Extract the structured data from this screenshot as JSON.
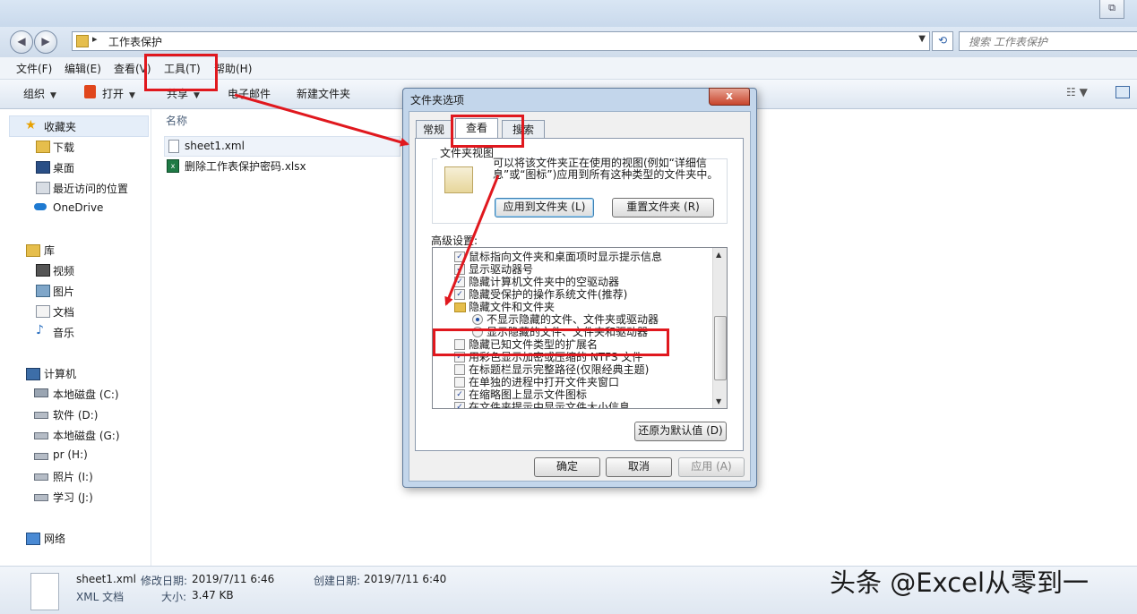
{
  "window": {
    "restore_glyph": "⧉"
  },
  "address": {
    "path": "工作表保护",
    "search_placeholder": "搜索 工作表保护"
  },
  "menu": [
    "文件(F)",
    "编辑(E)",
    "查看(V)",
    "工具(T)",
    "帮助(H)"
  ],
  "toolbar": {
    "organize": "组织",
    "open": "打开",
    "share": "共享",
    "email": "电子邮件",
    "new_folder": "新建文件夹"
  },
  "nav": {
    "favorites": "收藏夹",
    "fav_items": [
      "下载",
      "桌面",
      "最近访问的位置",
      "OneDrive"
    ],
    "library": "库",
    "lib_items": [
      "视频",
      "图片",
      "文档",
      "音乐"
    ],
    "computer": "计算机",
    "drives": [
      "本地磁盘 (C:)",
      "软件 (D:)",
      "本地磁盘 (G:)",
      "pr (H:)",
      "照片 (I:)",
      "学习 (J:)"
    ],
    "network": "网络"
  },
  "content": {
    "col_name": "名称",
    "files": [
      "sheet1.xml",
      "删除工作表保护密码.xlsx"
    ]
  },
  "status": {
    "filename": "sheet1.xml",
    "modified_label": "修改日期:",
    "modified": "2019/7/11 6:46",
    "created_label": "创建日期:",
    "created": "2019/7/11 6:40",
    "type": "XML 文档",
    "size_label": "大小:",
    "size": "3.47 KB"
  },
  "watermark": "头条 @Excel从零到一",
  "dialog": {
    "title": "文件夹选项",
    "close": "x",
    "tabs": [
      "常规",
      "查看",
      "搜索"
    ],
    "group_label": "文件夹视图",
    "group_desc": "可以将该文件夹正在使用的视图(例如“详细信息”或“图标”)应用到所有这种类型的文件夹中。",
    "apply_to_folders": "应用到文件夹 (L)",
    "reset_folders": "重置文件夹 (R)",
    "advanced_label": "高级设置:",
    "settings": [
      {
        "kind": "check",
        "checked": true,
        "label": "鼠标指向文件夹和桌面项时显示提示信息"
      },
      {
        "kind": "check",
        "checked": true,
        "label": "显示驱动器号"
      },
      {
        "kind": "check",
        "checked": true,
        "label": "隐藏计算机文件夹中的空驱动器"
      },
      {
        "kind": "check",
        "checked": true,
        "label": "隐藏受保护的操作系统文件(推荐)"
      },
      {
        "kind": "folder",
        "label": "隐藏文件和文件夹"
      },
      {
        "kind": "radio",
        "checked": true,
        "label": "不显示隐藏的文件、文件夹或驱动器"
      },
      {
        "kind": "radio",
        "checked": false,
        "label": "显示隐藏的文件、文件夹和驱动器"
      },
      {
        "kind": "check",
        "checked": false,
        "label": "隐藏已知文件类型的扩展名"
      },
      {
        "kind": "check",
        "checked": true,
        "label": "用彩色显示加密或压缩的 NTFS 文件"
      },
      {
        "kind": "check",
        "checked": false,
        "label": "在标题栏显示完整路径(仅限经典主题)"
      },
      {
        "kind": "check",
        "checked": false,
        "label": "在单独的进程中打开文件夹窗口"
      },
      {
        "kind": "check",
        "checked": true,
        "label": "在缩略图上显示文件图标"
      },
      {
        "kind": "check",
        "checked": true,
        "label": "在文件夹提示中显示文件大小信息"
      }
    ],
    "restore_defaults": "还原为默认值 (D)",
    "ok": "确定",
    "cancel": "取消",
    "apply": "应用 (A)"
  },
  "colors": {
    "annotation_red": "#e0181e",
    "dialog_frame": "#c3d6eb"
  }
}
